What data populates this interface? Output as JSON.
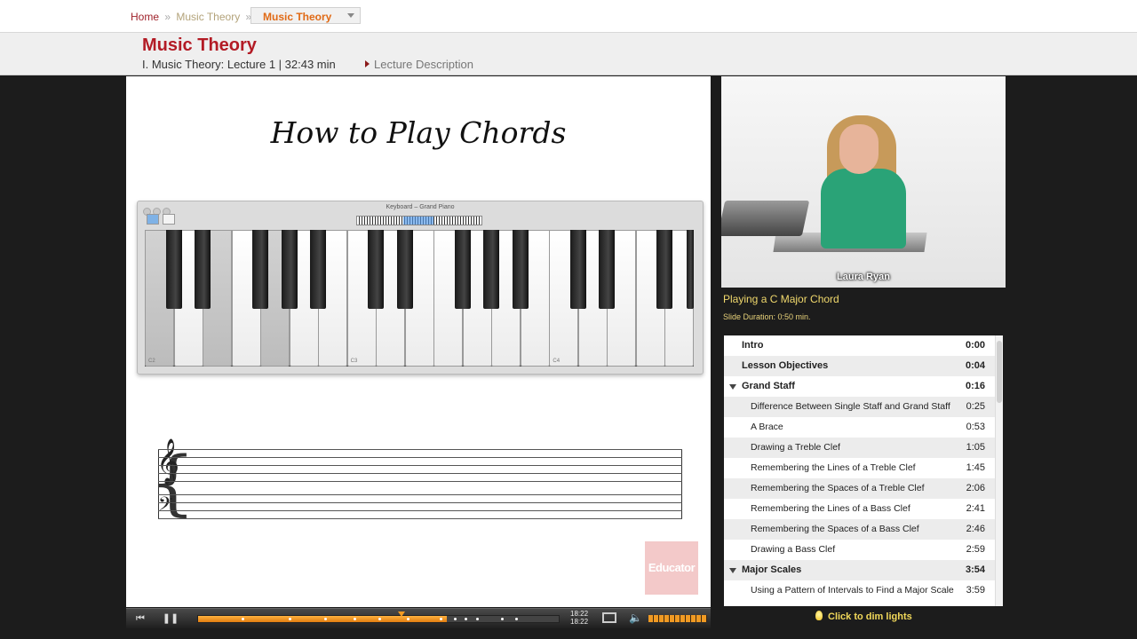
{
  "breadcrumb": {
    "home": "Home",
    "sep": "»",
    "course": "Music Theory",
    "dropdown": "Music Theory"
  },
  "header": {
    "course_title": "Music Theory",
    "lecture_info": "I. Music Theory: Lecture 1 | 32:43 min",
    "lecture_description": "Lecture Description"
  },
  "slide": {
    "title": "How to Play Chords",
    "keyboard_window_title": "Keyboard – Grand Piano",
    "key_labels": [
      "C2",
      "C3",
      "C4"
    ],
    "logo": "Educator"
  },
  "player": {
    "time_current": "18:22",
    "time_total": "18:22",
    "progress": 0.69,
    "volume": 1.0,
    "icons": [
      "skip-back-icon",
      "pause-icon",
      "screen-icon",
      "volume-icon"
    ]
  },
  "video": {
    "presenter_name": "Laura Ryan"
  },
  "slide_info": {
    "name": "Playing a C Major Chord",
    "duration": "Slide Duration: 0:50 min."
  },
  "toc": [
    {
      "title": "Intro",
      "time": "0:00",
      "level": "section"
    },
    {
      "title": "Lesson Objectives",
      "time": "0:04",
      "level": "section"
    },
    {
      "title": "Grand Staff",
      "time": "0:16",
      "level": "section",
      "expanded": true
    },
    {
      "title": "Difference Between Single Staff and Grand Staff",
      "time": "0:25",
      "level": "sub"
    },
    {
      "title": "A Brace",
      "time": "0:53",
      "level": "sub"
    },
    {
      "title": "Drawing a Treble Clef",
      "time": "1:05",
      "level": "sub"
    },
    {
      "title": "Remembering the Lines of a Treble Clef",
      "time": "1:45",
      "level": "sub"
    },
    {
      "title": "Remembering the Spaces of a Treble Clef",
      "time": "2:06",
      "level": "sub"
    },
    {
      "title": "Remembering the Lines of a Bass Clef",
      "time": "2:41",
      "level": "sub"
    },
    {
      "title": "Remembering the Spaces of a Bass Clef",
      "time": "2:46",
      "level": "sub"
    },
    {
      "title": "Drawing a Bass Clef",
      "time": "2:59",
      "level": "sub"
    },
    {
      "title": "Major Scales",
      "time": "3:54",
      "level": "section",
      "expanded": true
    },
    {
      "title": "Using a Pattern of Intervals to Find a Major Scale",
      "time": "3:59",
      "level": "sub"
    }
  ],
  "dim_lights": "Click to dim lights"
}
